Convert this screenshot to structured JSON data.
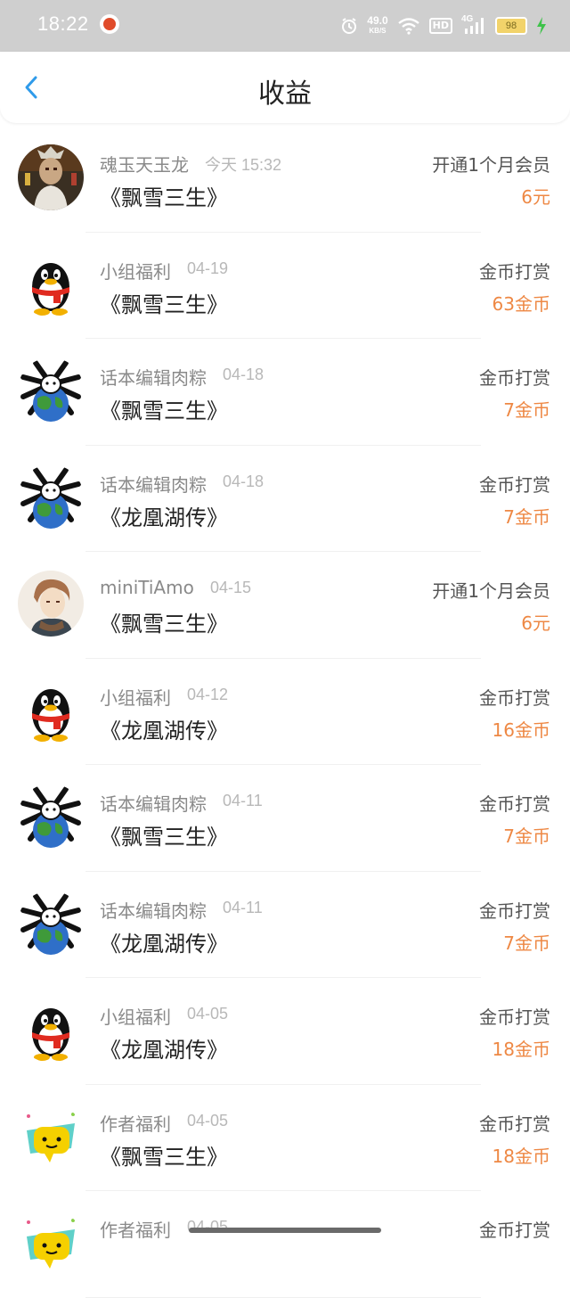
{
  "status_bar": {
    "time": "18:22",
    "net_speed": "49.0",
    "net_unit": "KB/S",
    "hd": "HD",
    "network": "4G",
    "battery": "98"
  },
  "header": {
    "title": "收益"
  },
  "colors": {
    "amount": "#ee8844",
    "back_icon": "#2f9bea"
  },
  "records": [
    {
      "name": "魂玉天玉龙",
      "date": "今天 15:32",
      "book": "《飘雪三生》",
      "type": "开通1个月会员",
      "amount": "6元",
      "avatar": "anime-avatar"
    },
    {
      "name": "小组福利",
      "date": "04-19",
      "book": "《飘雪三生》",
      "type": "金币打赏",
      "amount": "63金币",
      "avatar": "qq-penguin-avatar"
    },
    {
      "name": "话本编辑肉粽",
      "date": "04-18",
      "book": "《飘雪三生》",
      "type": "金币打赏",
      "amount": "7金币",
      "avatar": "spider-globe-avatar"
    },
    {
      "name": "话本编辑肉粽",
      "date": "04-18",
      "book": "《龙凰湖传》",
      "type": "金币打赏",
      "amount": "7金币",
      "avatar": "spider-globe-avatar"
    },
    {
      "name": "miniTiAmo",
      "date": "04-15",
      "book": "《飘雪三生》",
      "type": "开通1个月会员",
      "amount": "6元",
      "avatar": "anime-portrait-avatar"
    },
    {
      "name": "小组福利",
      "date": "04-12",
      "book": "《龙凰湖传》",
      "type": "金币打赏",
      "amount": "16金币",
      "avatar": "qq-penguin-avatar"
    },
    {
      "name": "话本编辑肉粽",
      "date": "04-11",
      "book": "《飘雪三生》",
      "type": "金币打赏",
      "amount": "7金币",
      "avatar": "spider-globe-avatar"
    },
    {
      "name": "话本编辑肉粽",
      "date": "04-11",
      "book": "《龙凰湖传》",
      "type": "金币打赏",
      "amount": "7金币",
      "avatar": "spider-globe-avatar"
    },
    {
      "name": "小组福利",
      "date": "04-05",
      "book": "《龙凰湖传》",
      "type": "金币打赏",
      "amount": "18金币",
      "avatar": "qq-penguin-avatar"
    },
    {
      "name": "作者福利",
      "date": "04-05",
      "book": "《飘雪三生》",
      "type": "金币打赏",
      "amount": "18金币",
      "avatar": "chat-bubble-avatar"
    },
    {
      "name": "作者福利",
      "date": "04-05",
      "book": "",
      "type": "金币打赏",
      "amount": "",
      "avatar": "chat-bubble-avatar"
    }
  ]
}
